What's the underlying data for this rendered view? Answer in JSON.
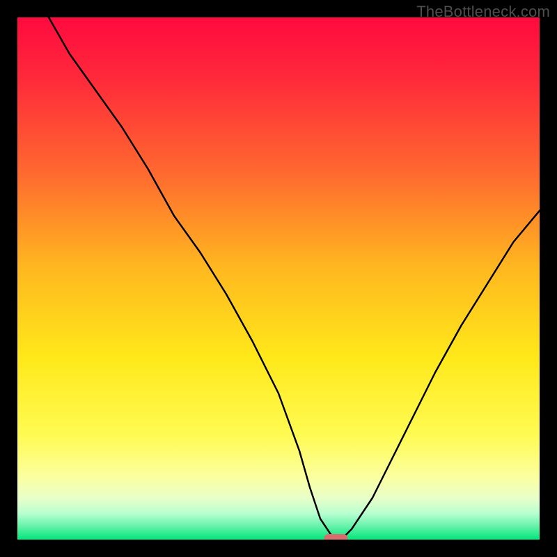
{
  "watermark": "TheBottleneck.com",
  "chart_data": {
    "type": "line",
    "title": "",
    "xlabel": "",
    "ylabel": "",
    "xlim": [
      0,
      100
    ],
    "ylim": [
      0,
      100
    ],
    "legend": false,
    "grid": false,
    "background": {
      "type": "vertical-gradient",
      "stops": [
        {
          "pos": 0.0,
          "color": "#ff0a3f"
        },
        {
          "pos": 0.12,
          "color": "#ff2a3a"
        },
        {
          "pos": 0.3,
          "color": "#ff6a2f"
        },
        {
          "pos": 0.48,
          "color": "#ffb81f"
        },
        {
          "pos": 0.65,
          "color": "#ffe81a"
        },
        {
          "pos": 0.8,
          "color": "#fffb52"
        },
        {
          "pos": 0.88,
          "color": "#fbffa0"
        },
        {
          "pos": 0.92,
          "color": "#e9ffc8"
        },
        {
          "pos": 0.95,
          "color": "#b8ffd0"
        },
        {
          "pos": 0.975,
          "color": "#63f2a8"
        },
        {
          "pos": 1.0,
          "color": "#02e67a"
        }
      ]
    },
    "series": [
      {
        "name": "bottleneck-curve",
        "x": [
          6,
          10,
          15,
          20,
          25,
          30,
          35,
          40,
          45,
          50,
          54,
          56,
          58,
          60,
          62,
          64,
          68,
          72,
          76,
          80,
          85,
          90,
          95,
          100
        ],
        "y": [
          100,
          93,
          86,
          79,
          71,
          62,
          55,
          47,
          38,
          28,
          17,
          10,
          4,
          1,
          0,
          2,
          8,
          16,
          24,
          32,
          41,
          49,
          57,
          63
        ]
      }
    ],
    "marker": {
      "name": "optimal-point",
      "x": 61,
      "y": 0,
      "width_pct": 4.5,
      "height_pct": 1.6,
      "color": "#d86e6d"
    }
  }
}
